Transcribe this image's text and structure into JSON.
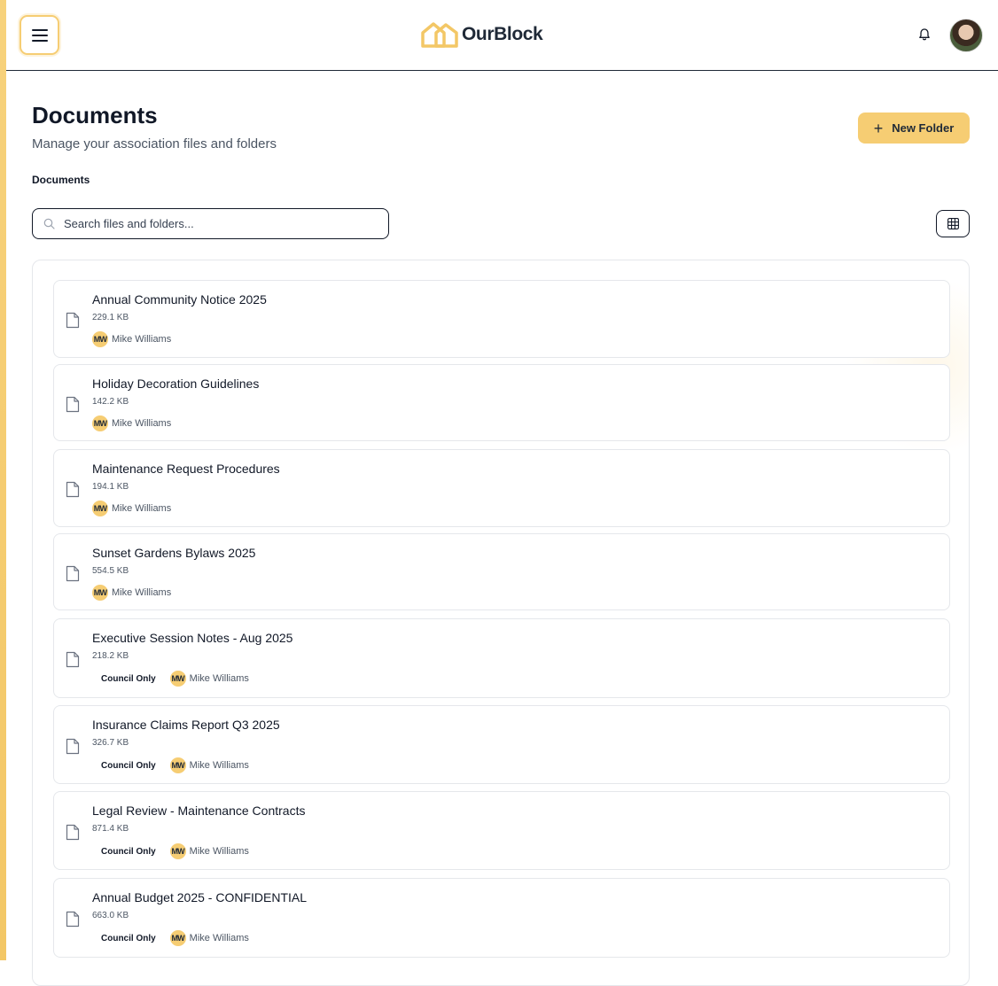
{
  "header": {
    "brand": "OurBlock",
    "menu_icon": "hamburger-icon",
    "notification_icon": "bell-icon"
  },
  "colors": {
    "accent": "#f6cd73",
    "text": "#111827",
    "muted": "#4b5563",
    "border": "#e5e7eb"
  },
  "page": {
    "title": "Documents",
    "subtitle": "Manage your association files and folders",
    "new_folder_label": "New Folder",
    "breadcrumb": "Documents"
  },
  "search": {
    "placeholder": "Search files and folders...",
    "value": ""
  },
  "files": [
    {
      "name": "Annual Community Notice 2025",
      "size": "229.1 KB",
      "badge": "",
      "initials": "MW",
      "owner": "Mike Williams"
    },
    {
      "name": "Holiday Decoration Guidelines",
      "size": "142.2 KB",
      "badge": "",
      "initials": "MW",
      "owner": "Mike Williams"
    },
    {
      "name": "Maintenance Request Procedures",
      "size": "194.1 KB",
      "badge": "",
      "initials": "MW",
      "owner": "Mike Williams"
    },
    {
      "name": "Sunset Gardens Bylaws 2025",
      "size": "554.5 KB",
      "badge": "",
      "initials": "MW",
      "owner": "Mike Williams"
    },
    {
      "name": "Executive Session Notes - Aug 2025",
      "size": "218.2 KB",
      "badge": "Council Only",
      "initials": "MW",
      "owner": "Mike Williams"
    },
    {
      "name": "Insurance Claims Report Q3 2025",
      "size": "326.7 KB",
      "badge": "Council Only",
      "initials": "MW",
      "owner": "Mike Williams"
    },
    {
      "name": "Legal Review - Maintenance Contracts",
      "size": "871.4 KB",
      "badge": "Council Only",
      "initials": "MW",
      "owner": "Mike Williams"
    },
    {
      "name": "Annual Budget 2025 - CONFIDENTIAL",
      "size": "663.0 KB",
      "badge": "Council Only",
      "initials": "MW",
      "owner": "Mike Williams"
    }
  ]
}
